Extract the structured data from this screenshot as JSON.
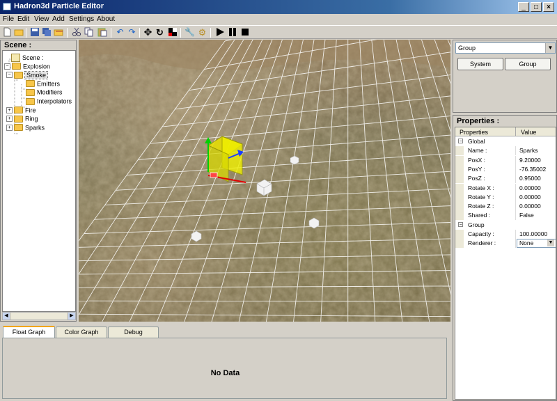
{
  "window": {
    "title": "Hadron3d Particle Editor",
    "min": "_",
    "max": "□",
    "close": "×"
  },
  "menu": [
    "File",
    "Edit",
    "View",
    "Add",
    "Settings",
    "About"
  ],
  "toolbar_icons": [
    "new-file-icon",
    "open-folder-icon",
    "save-icon",
    "save-all-icon",
    "open-icon",
    "cut-icon",
    "copy-icon",
    "paste-icon",
    "undo-icon",
    "redo-icon",
    "move-icon",
    "rotate-icon",
    "scale-icon",
    "wrench-icon",
    "gear-icon",
    "play-icon",
    "pause-icon",
    "stop-icon"
  ],
  "scene": {
    "title": "Scene :",
    "tree": [
      {
        "label": "Scene :",
        "level": 0,
        "expander": "",
        "icon": "scene"
      },
      {
        "label": "Explosion",
        "level": 0,
        "expander": "−",
        "icon": "folder"
      },
      {
        "label": "Smoke",
        "level": 1,
        "expander": "−",
        "icon": "folder",
        "selected": true
      },
      {
        "label": "Emitters",
        "level": 2,
        "expander": "",
        "icon": "folder"
      },
      {
        "label": "Modifiers",
        "level": 2,
        "expander": "",
        "icon": "folder"
      },
      {
        "label": "Interpolators",
        "level": 2,
        "expander": "",
        "icon": "folder"
      },
      {
        "label": "Fire",
        "level": 1,
        "expander": "+",
        "icon": "folder"
      },
      {
        "label": "Ring",
        "level": 1,
        "expander": "+",
        "icon": "folder"
      },
      {
        "label": "Sparks",
        "level": 1,
        "expander": "+",
        "icon": "folder"
      }
    ]
  },
  "group_panel": {
    "selected": "Group",
    "btn_system": "System",
    "btn_group": "Group"
  },
  "properties": {
    "title": "Properties :",
    "col_name": "Properties",
    "col_value": "Value",
    "rows": [
      {
        "type": "cat",
        "name": "Global"
      },
      {
        "type": "row",
        "name": "Name :",
        "value": "Sparks"
      },
      {
        "type": "row",
        "name": "PosX :",
        "value": "9.20000"
      },
      {
        "type": "row",
        "name": "PosY :",
        "value": "-76.35002"
      },
      {
        "type": "row",
        "name": "PosZ :",
        "value": "0.95000"
      },
      {
        "type": "row",
        "name": "Rotate X :",
        "value": "0.00000"
      },
      {
        "type": "row",
        "name": "Rotate Y :",
        "value": "0.00000"
      },
      {
        "type": "row",
        "name": "Rotate Z :",
        "value": "0.00000"
      },
      {
        "type": "row",
        "name": "Shared :",
        "value": "False"
      },
      {
        "type": "cat",
        "name": "Group"
      },
      {
        "type": "row",
        "name": "Capacity :",
        "value": "100.00000"
      },
      {
        "type": "row",
        "name": "Renderer :",
        "value": "None",
        "dropdown": true
      }
    ]
  },
  "graph": {
    "tabs": [
      "Float Graph",
      "Color Graph",
      "Debug"
    ],
    "active_tab": 0,
    "message": "No Data"
  }
}
